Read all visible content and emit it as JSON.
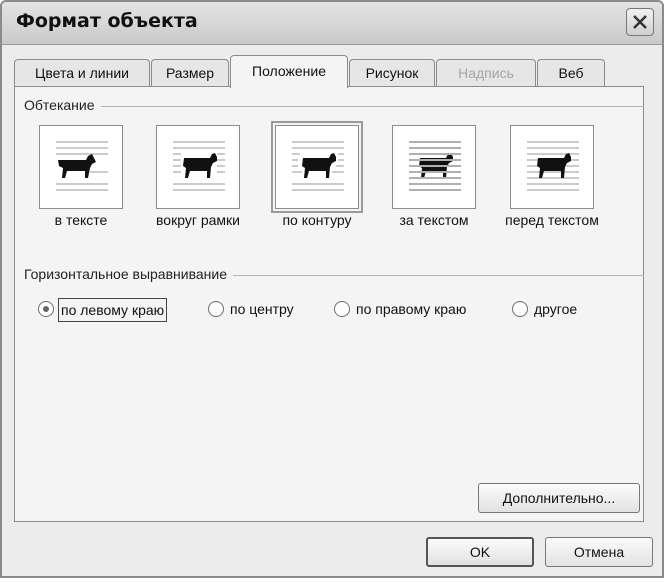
{
  "window": {
    "title": "Формат объекта"
  },
  "tabs": [
    {
      "label": "Цвета и линии",
      "state": "normal"
    },
    {
      "label": "Размер",
      "state": "normal"
    },
    {
      "label": "Положение",
      "state": "active"
    },
    {
      "label": "Рисунок",
      "state": "normal"
    },
    {
      "label": "Надпись",
      "state": "disabled"
    },
    {
      "label": "Веб",
      "state": "normal"
    }
  ],
  "wrapping": {
    "label": "Обтекание",
    "options": [
      {
        "label": "в тексте",
        "icon": "dog-inline-icon"
      },
      {
        "label": "вокруг рамки",
        "icon": "dog-square-icon"
      },
      {
        "label": "по контуру",
        "icon": "dog-tight-icon",
        "selected": true
      },
      {
        "label": "за текстом",
        "icon": "dog-behind-text-icon"
      },
      {
        "label": "перед текстом",
        "icon": "dog-in-front-icon"
      }
    ]
  },
  "horizontal_alignment": {
    "label": "Горизонтальное выравнивание",
    "options": [
      {
        "label": "по левому краю",
        "selected": true
      },
      {
        "label": "по центру"
      },
      {
        "label": "по правому краю"
      },
      {
        "label": "другое"
      }
    ]
  },
  "buttons": {
    "advanced": "Дополнительно...",
    "ok": "OK",
    "cancel": "Отмена"
  },
  "colors": {
    "titlebar": "#d4d4d4",
    "panel": "#f4f4f4",
    "selected_radio": "#666666"
  }
}
